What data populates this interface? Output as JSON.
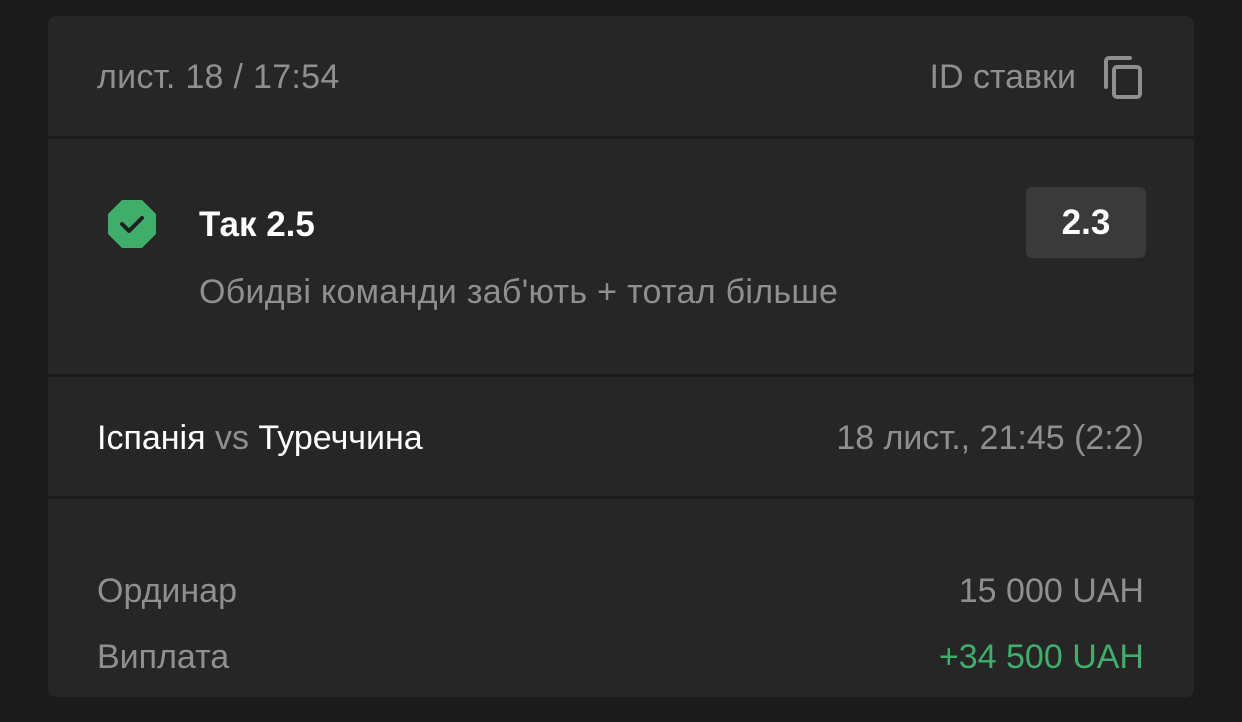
{
  "header": {
    "datetime": "лист. 18 / 17:54",
    "bet_id_label": "ID ставки",
    "copy_icon": "copy-icon"
  },
  "selection": {
    "status_icon": "check-badge-icon",
    "status_color": "#3fae6a",
    "title": "Так 2.5",
    "market": "Обидві команди заб'ють + тотал більше",
    "odds": "2.3"
  },
  "event": {
    "home": "Іспанія",
    "vs": "vs",
    "away": "Туреччина",
    "datetime_score": "18 лист., 21:45 (2:2)"
  },
  "summary": {
    "type_label": "Ординар",
    "stake": "15 000 UAH",
    "payout_label": "Виплата",
    "payout": "+34 500 UAH",
    "payout_color": "#3fae6a"
  }
}
